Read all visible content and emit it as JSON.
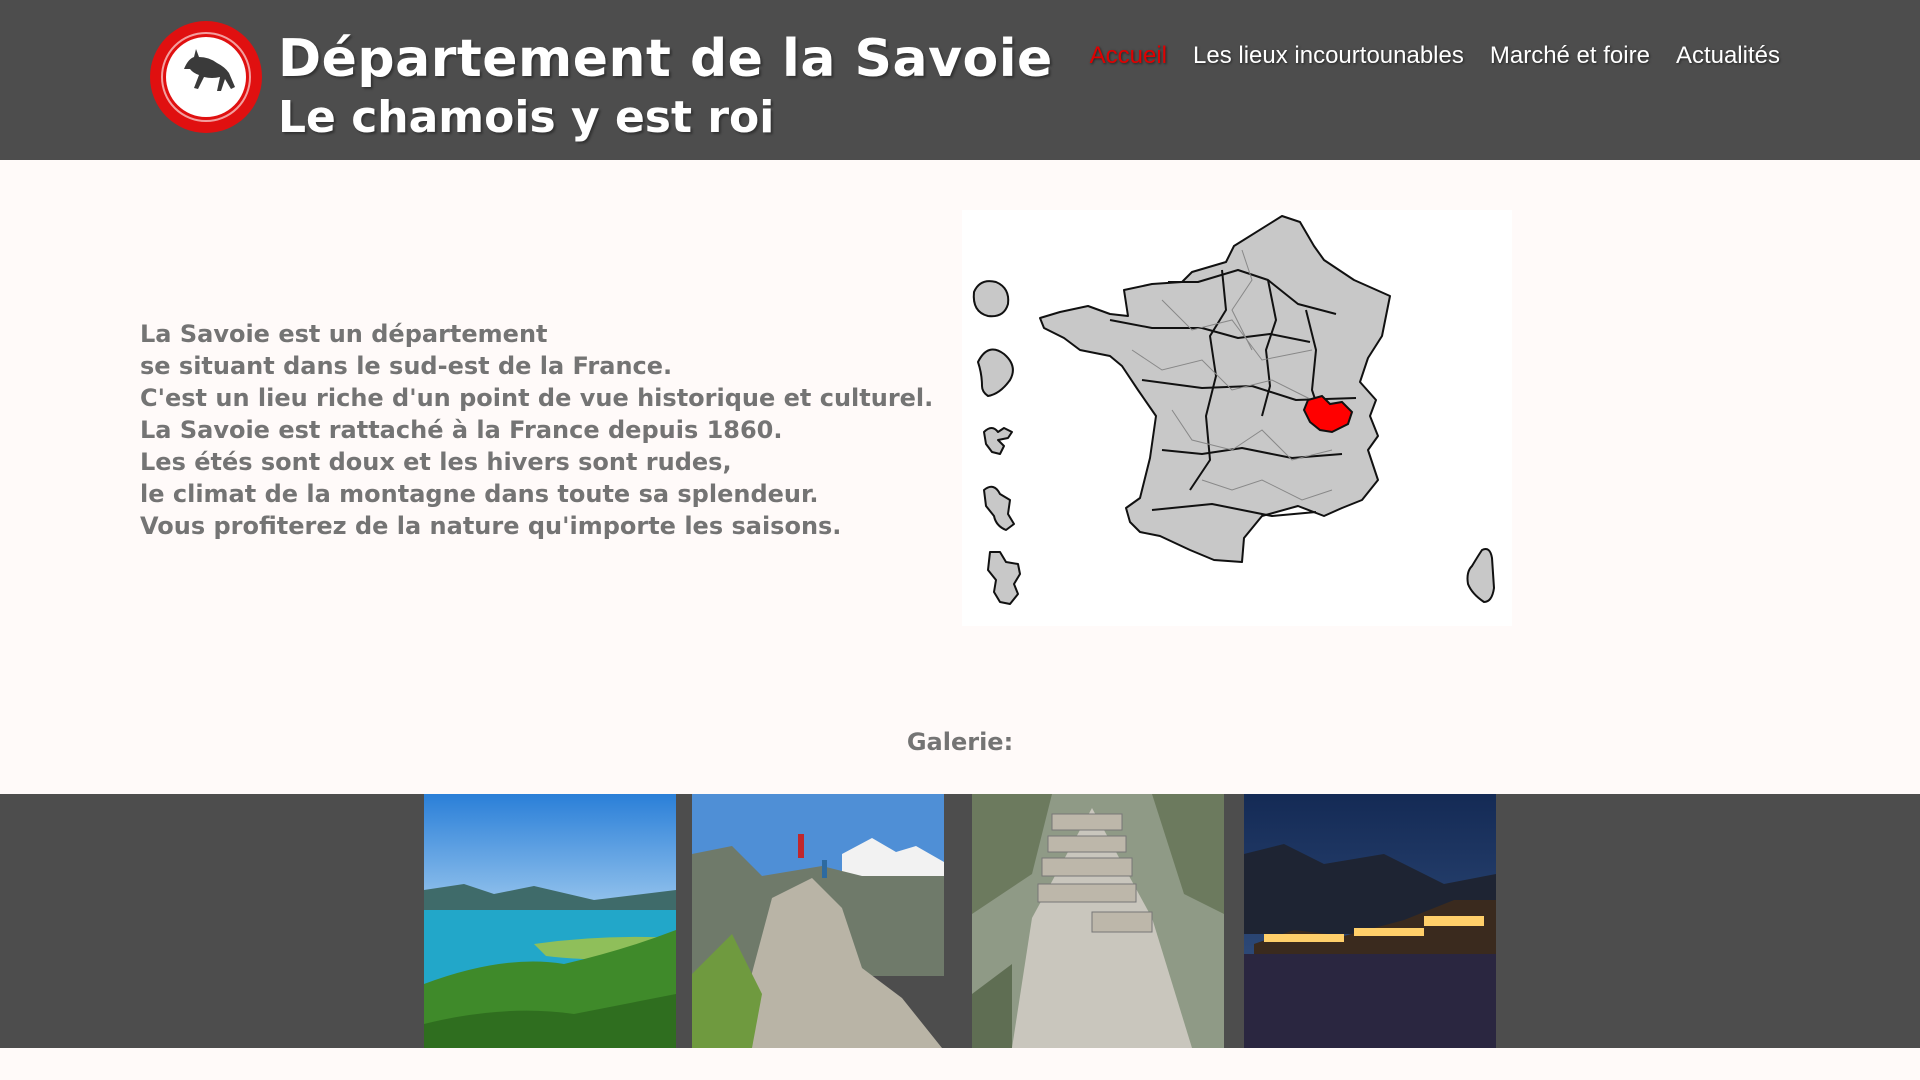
{
  "header": {
    "title": "Département de la Savoie",
    "subtitle": "Le chamois y est roi",
    "logo_icon": "chamois-logo-icon",
    "nav": [
      {
        "label": "Accueil",
        "active": true
      },
      {
        "label": "Les lieux incourtounables",
        "active": false
      },
      {
        "label": "Marché et foire",
        "active": false
      },
      {
        "label": "Actualités",
        "active": false
      }
    ]
  },
  "intro": {
    "lines": [
      "La Savoie est un département",
      "se situant dans le sud-est de la France.",
      "C'est un lieu riche d'un point de vue historique et culturel.",
      "La Savoie est rattaché à la France depuis 1860.",
      "Les étés sont doux et les hivers sont rudes,",
      "le climat de la montagne dans toute sa splendeur.",
      "Vous profiterez de la nature qu'importe les saisons."
    ]
  },
  "map": {
    "icon": "france-departments-map",
    "highlight_color": "#ff0000",
    "region_color": "#c8c8c8"
  },
  "gallery": {
    "label": "Galerie:",
    "photos": [
      {
        "icon": "lake-photo"
      },
      {
        "icon": "mountain-hikers-photo"
      },
      {
        "icon": "fortress-photo"
      },
      {
        "icon": "ski-resort-night-photo"
      }
    ]
  },
  "colors": {
    "header_bg": "#4d4d4d",
    "page_bg": "#fffaf9",
    "text_gray": "#747474",
    "nav_active": "#e00000"
  }
}
